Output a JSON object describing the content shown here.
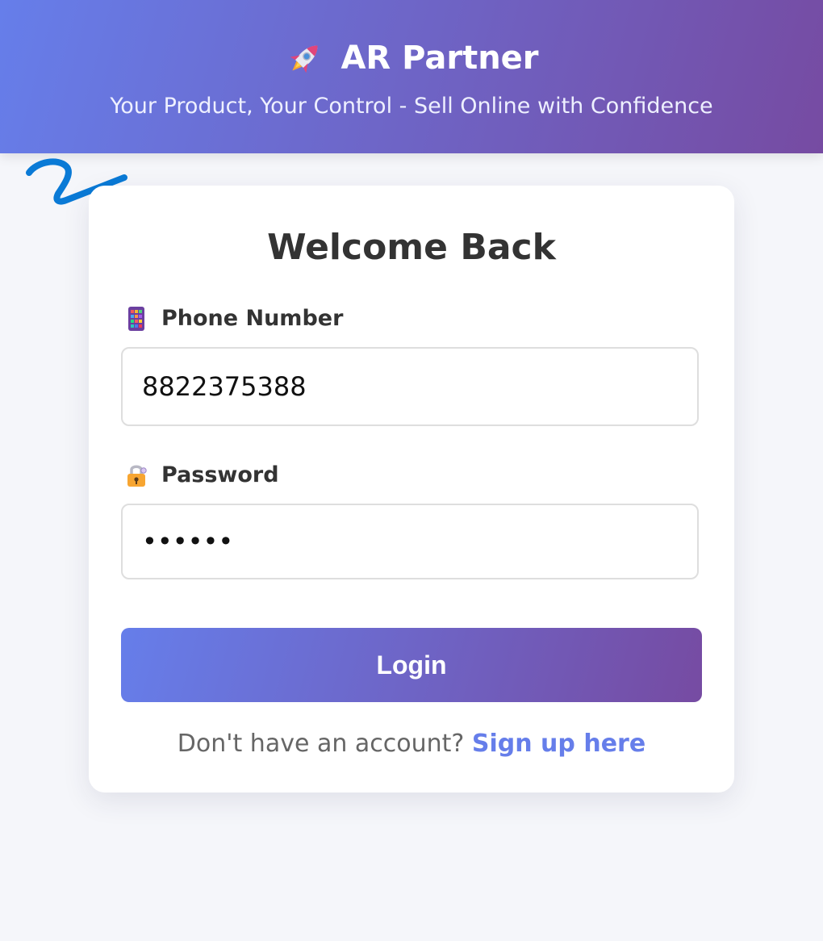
{
  "header": {
    "title": "AR Partner",
    "tagline": "Your Product, Your Control - Sell Online with Confidence",
    "icon": "rocket-icon"
  },
  "login": {
    "heading": "Welcome Back",
    "phone": {
      "icon": "phone-icon",
      "label": "Phone Number",
      "value": "8822375388"
    },
    "password": {
      "icon": "lock-icon",
      "label": "Password",
      "value": "••••••"
    },
    "submit_label": "Login",
    "signup_prompt": "Don't have an account?",
    "signup_link": "Sign up here"
  },
  "colors": {
    "gradient_start": "#667eea",
    "gradient_end": "#764ba2",
    "background": "#f5f6fa",
    "annotation_stroke": "#0a7ad6"
  }
}
